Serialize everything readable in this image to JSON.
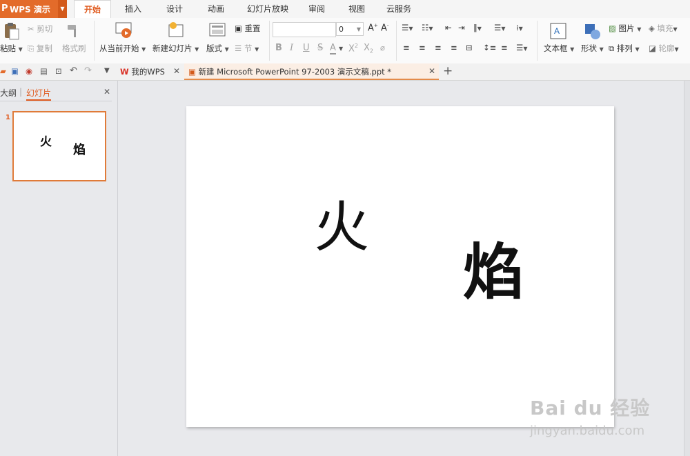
{
  "app": {
    "name": "WPS 演示",
    "logo_letter": "P"
  },
  "ribbon_tabs": [
    "开始",
    "插入",
    "设计",
    "动画",
    "幻灯片放映",
    "审阅",
    "视图",
    "云服务"
  ],
  "ribbon": {
    "paste": "粘贴",
    "cut": "剪切",
    "copy": "复制",
    "format_painter": "格式刷",
    "from_current": "从当前开始",
    "new_slide": "新建幻灯片",
    "layout": "版式",
    "reset": "重置",
    "section": "节",
    "font_name": "",
    "font_size": "0",
    "font_grow": "A",
    "font_shrink": "A",
    "bold": "B",
    "italic": "I",
    "underline": "U",
    "strike": "S",
    "font_color": "A",
    "superscript": "X",
    "subscript": "X",
    "text_box": "文本框",
    "shape": "形状",
    "picture": "图片",
    "arrange": "排列",
    "fill": "填充",
    "outline": "轮廓"
  },
  "doc_tabs": {
    "home": "我的WPS",
    "current": "新建 Microsoft PowerPoint 97-2003 演示文稿.ppt *"
  },
  "left_panel": {
    "tab_outline": "大纲",
    "tab_slides": "幻灯片",
    "slide_number": "1"
  },
  "slide": {
    "text1": "火",
    "text2": "焰"
  },
  "watermark": {
    "brand": "Bai du 经验",
    "site": "jingyan.baidu.com"
  },
  "colors": {
    "accent": "#e36b2a",
    "active_tab_text": "#e05a1e",
    "thumb_border": "#e07b39"
  }
}
